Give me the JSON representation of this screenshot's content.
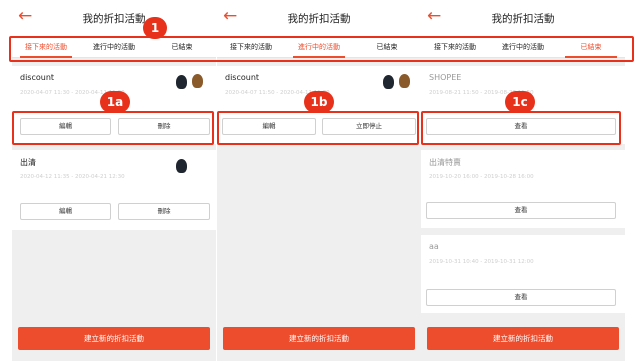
{
  "app": {
    "title": "我的折扣活動",
    "back_icon": "←"
  },
  "tabs": [
    "接下來的活動",
    "進行中的活動",
    "已結束"
  ],
  "colors": {
    "accent": "#ee4d2d",
    "annotation": "#e8311b"
  },
  "panels": [
    {
      "active_tab": 0,
      "cards": [
        {
          "name": "discount",
          "date": "2020-04-07 11:30 - 2020-04-11 11:30",
          "buttons": [
            "編輯",
            "刪除"
          ],
          "avatars": [
            "dark-avatar",
            "brown-avatar"
          ]
        },
        {
          "name": "出清",
          "date": "2020-04-12 11:35 - 2020-04-21 12:30",
          "buttons": [
            "編輯",
            "刪除"
          ],
          "avatars": [
            "dark-avatar"
          ]
        }
      ]
    },
    {
      "active_tab": 1,
      "cards": [
        {
          "name": "discount",
          "date": "2020-04-07 11:50 - 2020-04-11 11:30",
          "buttons": [
            "編輯",
            "立即停止"
          ],
          "avatars": [
            "dark-avatar",
            "brown-avatar"
          ]
        }
      ]
    },
    {
      "active_tab": 2,
      "cards": [
        {
          "name": "SHOPEE",
          "date": "2019-08-21 11:50 - 2019-08-23 11:50",
          "buttons": [
            "查看"
          ]
        },
        {
          "name": "出清特賣",
          "date": "2019-10-20 16:00 - 2019-10-28 16:00",
          "buttons": [
            "查看"
          ]
        },
        {
          "name": "aa",
          "date": "2019-10-31 10:40 - 2019-10-31 12:00",
          "buttons": [
            "查看"
          ]
        }
      ]
    }
  ],
  "bottom_button": "建立新的折扣活動",
  "annotations": {
    "tabs": "1",
    "card_a": "1a",
    "card_b": "1b",
    "card_c": "1c"
  }
}
